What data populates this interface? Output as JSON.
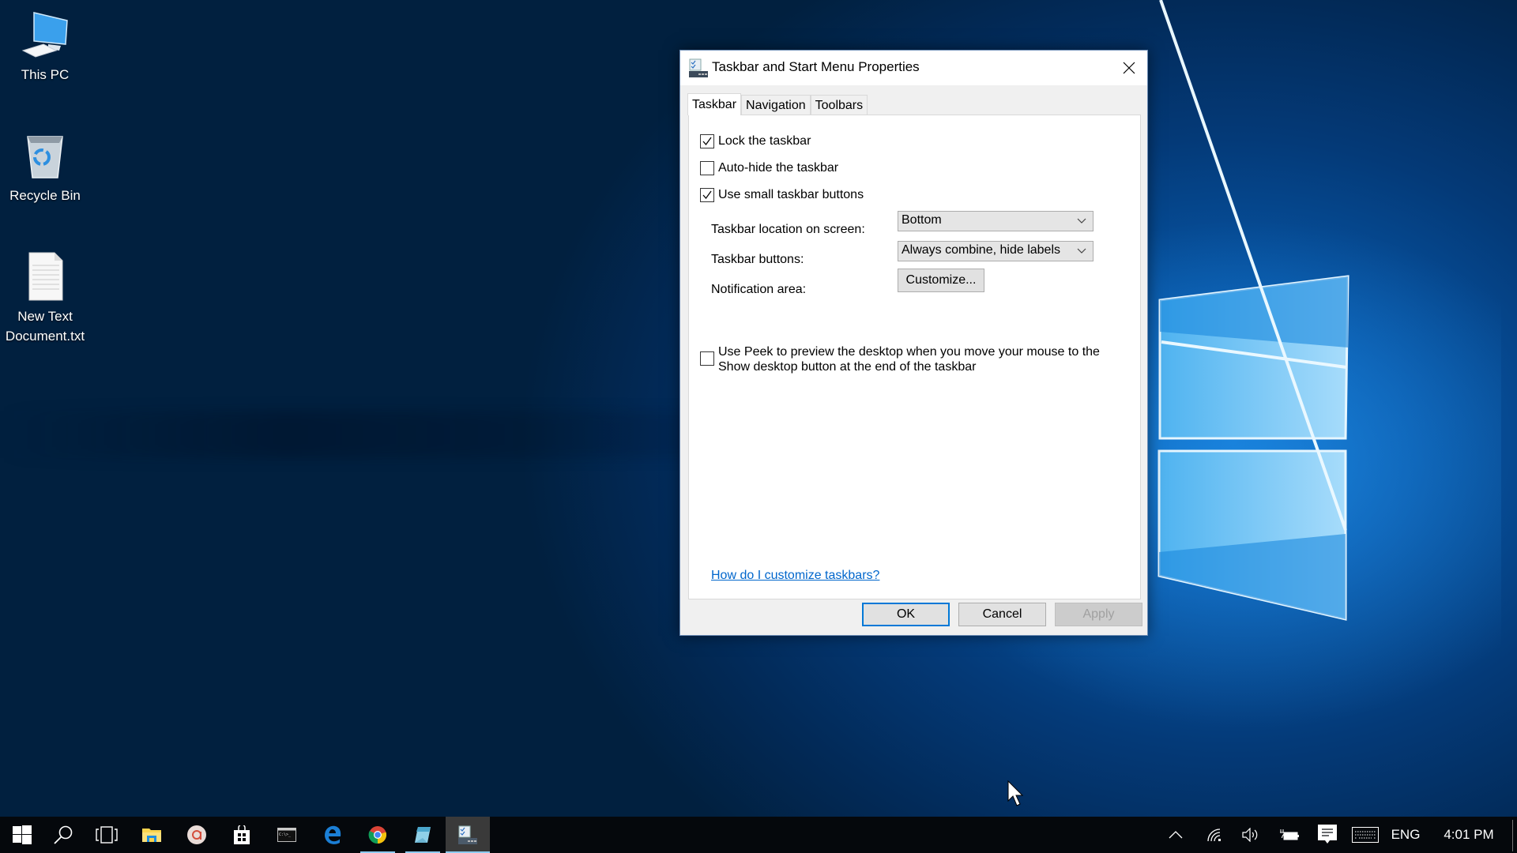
{
  "desktop": {
    "icons": [
      {
        "label": "This PC",
        "icon": "computer-icon"
      },
      {
        "label": "Recycle Bin",
        "icon": "recycle-bin-icon"
      },
      {
        "label_line1": "New Text",
        "label_line2": "Document.txt",
        "icon": "text-file-icon"
      }
    ]
  },
  "dialog": {
    "title": "Taskbar and Start Menu Properties",
    "tabs": [
      "Taskbar",
      "Navigation",
      "Toolbars"
    ],
    "active_tab": "Taskbar",
    "checkboxes": [
      {
        "label": "Lock the taskbar",
        "checked": true
      },
      {
        "label": "Auto-hide the taskbar",
        "checked": false
      },
      {
        "label": "Use small taskbar buttons",
        "checked": true
      }
    ],
    "location_label": "Taskbar location on screen:",
    "location_value": "Bottom",
    "buttons_label": "Taskbar buttons:",
    "buttons_value": "Always combine, hide labels",
    "notification_label": "Notification area:",
    "customize_button": "Customize...",
    "peek": {
      "line1": "Use Peek to preview the desktop when you move your mouse to the",
      "line2": "Show desktop button at the end of the taskbar",
      "checked": false
    },
    "help_link": "How do I customize taskbars?",
    "ok": "OK",
    "cancel": "Cancel",
    "apply": "Apply"
  },
  "taskbar": {
    "apps": [
      {
        "name": "start",
        "icon": "windows-start-icon"
      },
      {
        "name": "search",
        "icon": "search-icon"
      },
      {
        "name": "task-view",
        "icon": "task-view-icon"
      },
      {
        "name": "file-explorer",
        "icon": "folder-icon"
      },
      {
        "name": "app",
        "icon": "app-circle-icon"
      },
      {
        "name": "store",
        "icon": "store-icon"
      },
      {
        "name": "command-prompt",
        "icon": "terminal-icon"
      },
      {
        "name": "edge",
        "icon": "edge-icon"
      },
      {
        "name": "chrome",
        "icon": "chrome-icon",
        "running": true
      },
      {
        "name": "notepad",
        "icon": "notepad-icon",
        "running": true
      },
      {
        "name": "taskbar-properties",
        "icon": "taskbar-properties-icon",
        "running": true,
        "active": true
      }
    ],
    "tray": {
      "language": "ENG",
      "time": "4:01 PM"
    }
  },
  "colors": {
    "accent": "#0078d7",
    "link": "#0066cc",
    "taskbar": "#05080c",
    "running_indicator": "#8ecbf0"
  }
}
